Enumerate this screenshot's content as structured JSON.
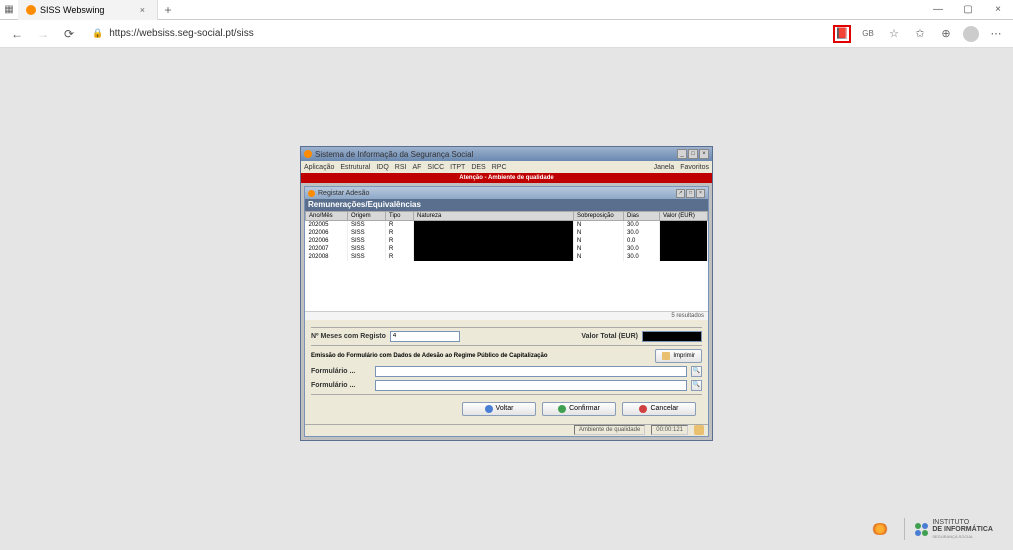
{
  "browser": {
    "tab_title": "SISS Webswing",
    "url": "https://websiss.seg-social.pt/siss",
    "toolbar_badge": "GB"
  },
  "app": {
    "title": "Sistema de Informação da Segurança Social",
    "menu": [
      "Aplicação",
      "Estrutural",
      "IDQ",
      "RSI",
      "AF",
      "SICC",
      "ITPT",
      "DES",
      "RPC"
    ],
    "menu_right": [
      "Janela",
      "Favoritos"
    ],
    "attention": "Atenção - Ambiente de qualidade"
  },
  "subwin": {
    "title": "Registar Adesão",
    "section": "Remunerações/Equivalências",
    "columns": [
      "Ano/Mês",
      "Origem",
      "Tipo",
      "Natureza",
      "Sobreposição",
      "Dias",
      "Valor (EUR)"
    ],
    "rows": [
      {
        "anomes": "202005",
        "origem": "SISS",
        "tipo": "R",
        "sobre": "N",
        "dias": "30.0"
      },
      {
        "anomes": "202006",
        "origem": "SISS",
        "tipo": "R",
        "sobre": "N",
        "dias": "30.0"
      },
      {
        "anomes": "202006",
        "origem": "SISS",
        "tipo": "R",
        "sobre": "N",
        "dias": "0.0"
      },
      {
        "anomes": "202007",
        "origem": "SISS",
        "tipo": "R",
        "sobre": "N",
        "dias": "30.0"
      },
      {
        "anomes": "202008",
        "origem": "SISS",
        "tipo": "R",
        "sobre": "N",
        "dias": "30.0"
      }
    ],
    "results_footer": "5 resultados",
    "meses_label": "Nº Meses com Registo",
    "meses_value": "4",
    "valor_total_label": "Valor Total (EUR)",
    "emissao_label": "Emissão do Formulário com Dados de Adesão ao Regime Público de Capitalização",
    "imprimir": "Imprimir",
    "formulario_label": "Formulário ...",
    "buttons": {
      "voltar": "Voltar",
      "confirmar": "Confirmar",
      "cancelar": "Cancelar"
    }
  },
  "status": {
    "env": "Ambiente de qualidade",
    "time": "00:00:121"
  },
  "footer": {
    "inst1": "INSTITUTO",
    "inst2": "DE INFORMÁTICA",
    "inst3": "SEGURANÇA SOCIAL"
  }
}
